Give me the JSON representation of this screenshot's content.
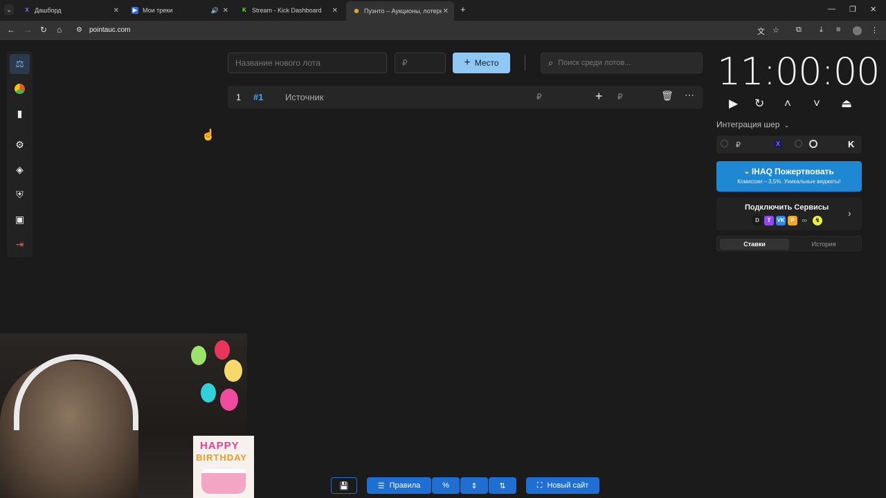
{
  "browser": {
    "tabs": [
      {
        "label": "Дашборд",
        "favicon": "X",
        "color": "#5a5ae6"
      },
      {
        "label": "Мои треки",
        "favicon": "▶",
        "color": "#2f6fe0"
      },
      {
        "label": "Stream - Kick Dashboard",
        "favicon": "K",
        "color": "#53fc18"
      },
      {
        "label": "Пуэнто – Аукционы, лотереи",
        "favicon": "◉",
        "color": "#e0b030"
      }
    ],
    "new_tab": "+",
    "url": "pointauc.com"
  },
  "lot_form": {
    "name_placeholder": "Название нового лота",
    "amount_placeholder": "₽",
    "add_label": "Место",
    "search_placeholder": "Поиск среди лотов..."
  },
  "lots": [
    {
      "index": "1",
      "id": "#1",
      "name": "Источник",
      "amount": "₽",
      "add_currency": "₽"
    }
  ],
  "timer": {
    "value": "11:00:00"
  },
  "integration": {
    "title": "Интеграция шер",
    "currency": "₽"
  },
  "donate": {
    "title": "IHAQ Пожертвовать",
    "subtitle": "Комиссии – 3,5%. Уникальные виджеты!"
  },
  "services": {
    "title": "Подключить Сервисы"
  },
  "bids_tabs": {
    "bids": "Ставки",
    "history": "История"
  },
  "bottom_toolbar": {
    "rules": "Правила",
    "new_site": "Новый сайт"
  },
  "overlay": {
    "cake_text_1": "HAPPY",
    "cake_text_2": "BIRTHDAY"
  }
}
